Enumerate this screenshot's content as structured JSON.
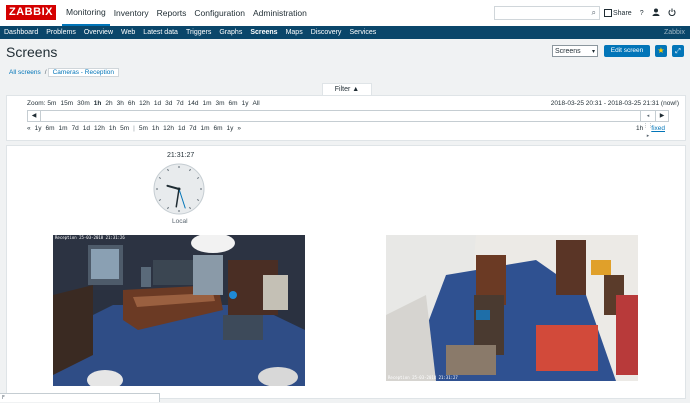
{
  "app": {
    "logo": "ZABBIX",
    "brand": "Zabbix"
  },
  "main_menu": [
    {
      "label": "Monitoring",
      "active": true
    },
    {
      "label": "Inventory"
    },
    {
      "label": "Reports"
    },
    {
      "label": "Configuration"
    },
    {
      "label": "Administration"
    }
  ],
  "search": {
    "placeholder": ""
  },
  "top_icons": {
    "share": "Share",
    "help": "?",
    "user": "user-icon",
    "power": "power-icon"
  },
  "sub_menu": [
    "Dashboard",
    "Problems",
    "Overview",
    "Web",
    "Latest data",
    "Triggers",
    "Graphs",
    "Screens",
    "Maps",
    "Discovery",
    "Services"
  ],
  "sub_menu_active": "Screens",
  "page": {
    "title": "Screens",
    "screen_select": "Screens",
    "edit_button": "Edit screen"
  },
  "breadcrumb": {
    "root": "All screens",
    "separator": "/",
    "current": "Cameras - Reception"
  },
  "filter": {
    "tab_label": "Filter",
    "zoom_label": "Zoom:",
    "zoom_items": [
      "5m",
      "15m",
      "30m",
      "1h",
      "2h",
      "3h",
      "6h",
      "12h",
      "1d",
      "3d",
      "7d",
      "14d",
      "1m",
      "3m",
      "6m",
      "1y",
      "All"
    ],
    "zoom_active": "1h",
    "date_range": "2018-03-25 20:31 - 2018-03-25 21:31 (now!)",
    "nav_back_marker": "«",
    "nav_back": [
      "1y",
      "6m",
      "1m",
      "7d",
      "1d",
      "12h",
      "1h",
      "5m"
    ],
    "nav_separator": "|",
    "nav_forward": [
      "5m",
      "1h",
      "12h",
      "1d",
      "7d",
      "1m",
      "6m",
      "1y"
    ],
    "nav_forward_marker": "»",
    "period": "1h",
    "fixed": "fixed"
  },
  "clock": {
    "time": "21:31:27",
    "label": "Local",
    "hour": 21,
    "minute": 31,
    "second": 27
  },
  "cameras": [
    {
      "timestamp": "Reception 25-03-2018 21:31:26"
    },
    {
      "timestamp": "Reception 25-03-2018 21:31:27"
    }
  ],
  "status_bar": {
    "text": "F"
  }
}
